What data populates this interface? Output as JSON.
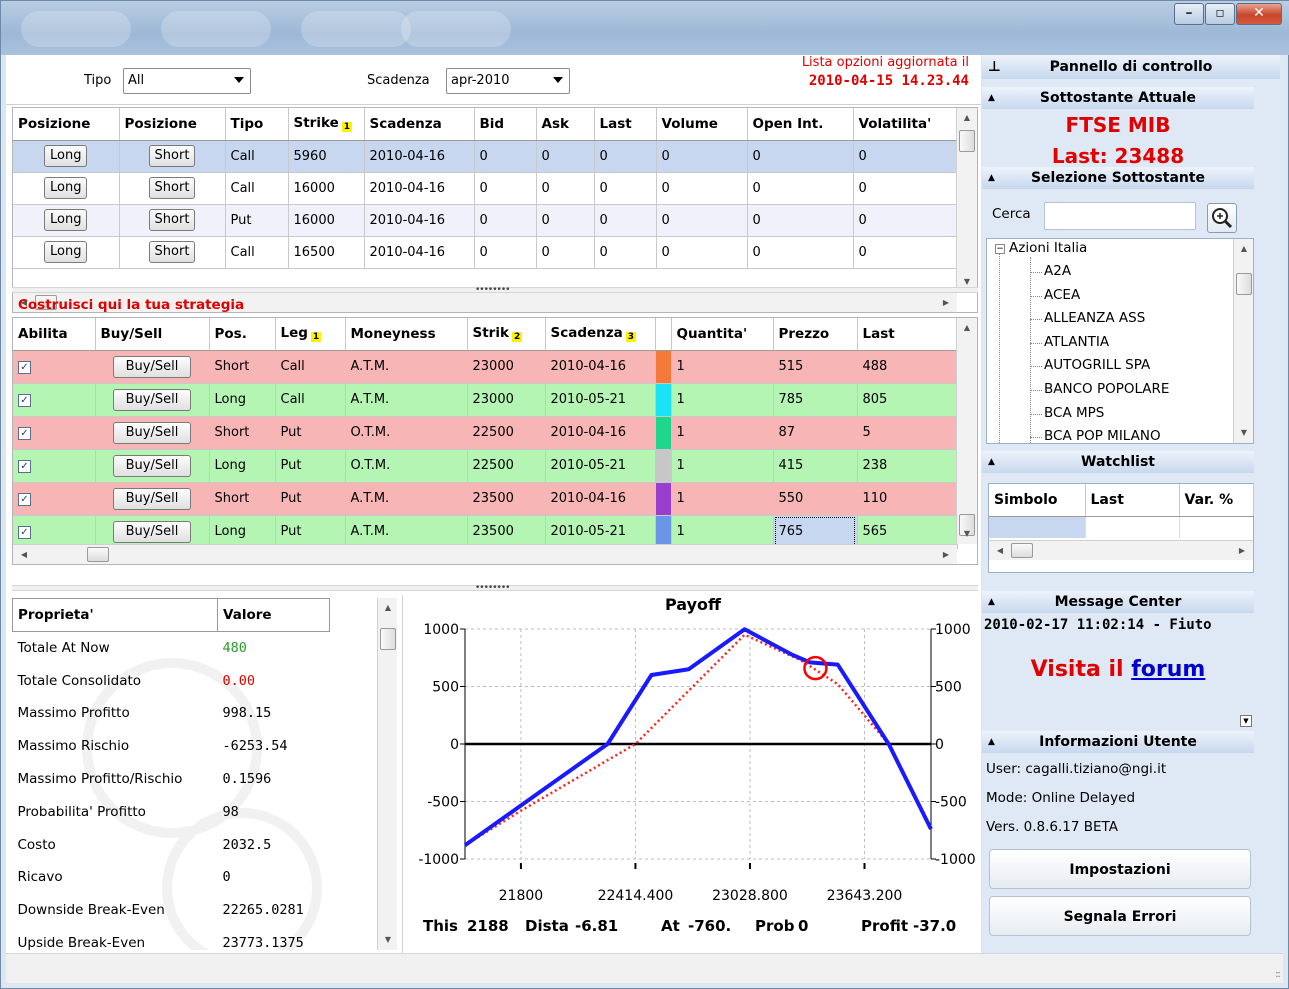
{
  "window": {
    "controls": [
      "minimize",
      "maximize",
      "close"
    ]
  },
  "filters": {
    "tipo_label": "Tipo",
    "tipo_value": "All",
    "scadenza_label": "Scadenza",
    "scadenza_value": "apr-2010",
    "updated_label": "Lista opzioni aggiornata il",
    "updated_value": "2010-04-15 14.23.44"
  },
  "options_table": {
    "columns": [
      "Posizione",
      "Posizione",
      "Tipo",
      "Strike",
      "Scadenza",
      "Bid",
      "Ask",
      "Last",
      "Volume",
      "Open Int.",
      "Volatilita'"
    ],
    "sort_badge": "1",
    "long_label": "Long",
    "short_label": "Short",
    "rows": [
      {
        "tipo": "Call",
        "strike": "5960",
        "scadenza": "2010-04-16",
        "bid": "0",
        "ask": "0",
        "last": "0",
        "volume": "0",
        "open_int": "0",
        "volatilita": "0"
      },
      {
        "tipo": "Call",
        "strike": "16000",
        "scadenza": "2010-04-16",
        "bid": "0",
        "ask": "0",
        "last": "0",
        "volume": "0",
        "open_int": "0",
        "volatilita": "0"
      },
      {
        "tipo": "Put",
        "strike": "16000",
        "scadenza": "2010-04-16",
        "bid": "0",
        "ask": "0",
        "last": "0",
        "volume": "0",
        "open_int": "0",
        "volatilita": "0"
      },
      {
        "tipo": "Call",
        "strike": "16500",
        "scadenza": "2010-04-16",
        "bid": "0",
        "ask": "0",
        "last": "0",
        "volume": "0",
        "open_int": "0",
        "volatilita": "0"
      }
    ]
  },
  "strategy": {
    "title": "Costruisci qui la tua strategia",
    "columns": [
      "Abilita",
      "Buy/Sell",
      "Pos.",
      "Leg",
      "Moneyness",
      "Strik",
      "Scadenza",
      "",
      "Quantita'",
      "Prezzo",
      "Last"
    ],
    "badges": {
      "leg": "1",
      "strik": "2",
      "scadenza": "3"
    },
    "button_label": "Buy/Sell",
    "check_glyph": "✓",
    "rows": [
      {
        "pos": "Short",
        "leg": "Call",
        "moneyness": "A.T.M.",
        "strik": "23000",
        "scadenza": "2010-04-16",
        "color": "#f4793a",
        "quantita": "1",
        "prezzo": "515",
        "last": "488"
      },
      {
        "pos": "Long",
        "leg": "Call",
        "moneyness": "A.T.M.",
        "strik": "23000",
        "scadenza": "2010-05-21",
        "color": "#18e2f4",
        "quantita": "1",
        "prezzo": "785",
        "last": "805"
      },
      {
        "pos": "Short",
        "leg": "Put",
        "moneyness": "O.T.M.",
        "strik": "22500",
        "scadenza": "2010-04-16",
        "color": "#1ed78d",
        "quantita": "1",
        "prezzo": "87",
        "last": "5"
      },
      {
        "pos": "Long",
        "leg": "Put",
        "moneyness": "O.T.M.",
        "strik": "22500",
        "scadenza": "2010-05-21",
        "color": "#c7c7c7",
        "quantita": "1",
        "prezzo": "415",
        "last": "238"
      },
      {
        "pos": "Short",
        "leg": "Put",
        "moneyness": "A.T.M.",
        "strik": "23500",
        "scadenza": "2010-04-16",
        "color": "#9a3ecf",
        "quantita": "1",
        "prezzo": "550",
        "last": "110"
      },
      {
        "pos": "Long",
        "leg": "Put",
        "moneyness": "A.T.M.",
        "strik": "23500",
        "scadenza": "2010-05-21",
        "color": "#6b96e8",
        "quantita": "1",
        "prezzo": "765",
        "last": "565"
      }
    ]
  },
  "properties": {
    "col_prop": "Proprieta'",
    "col_val": "Valore",
    "rows": [
      {
        "name": "Totale At Now",
        "value": "480",
        "color": "#2a9d2a"
      },
      {
        "name": "Totale Consolidato",
        "value": "0.00",
        "color": "#e00000"
      },
      {
        "name": "Massimo Profitto",
        "value": "998.15",
        "color": "#000000"
      },
      {
        "name": "Massimo Rischio",
        "value": "-6253.54",
        "color": "#000000"
      },
      {
        "name": "Massimo Profitto/Rischio",
        "value": "0.1596",
        "color": "#000000"
      },
      {
        "name": "Probabilita' Profitto",
        "value": "98",
        "color": "#000000"
      },
      {
        "name": "Costo",
        "value": "2032.5",
        "color": "#000000"
      },
      {
        "name": "Ricavo",
        "value": "0",
        "color": "#000000"
      },
      {
        "name": "Downside Break-Even",
        "value": "22265.0281",
        "color": "#000000"
      },
      {
        "name": "Upside Break-Even",
        "value": "23773.1375",
        "color": "#000000"
      }
    ]
  },
  "chart_data": {
    "type": "line",
    "title": "Payoff",
    "xlim": [
      21500,
      24000
    ],
    "ylim": [
      -1000,
      1000
    ],
    "y_ticks": [
      1000,
      500,
      0,
      -500,
      -1000
    ],
    "y_tick_labels": [
      "1000",
      "500",
      "0",
      "-500",
      "-1000"
    ],
    "x_tick_labels": [
      "21800",
      "22414.400",
      "23028.800",
      "23643.200"
    ],
    "x_tick_values": [
      21800,
      22414.4,
      23028.8,
      23643.2
    ],
    "grid": true,
    "series": [
      {
        "color": "#1a1aff",
        "style": "solid",
        "x": [
          21500,
          21900,
          22265,
          22500,
          22700,
          23000,
          23250,
          23350,
          23500,
          23773,
          24000
        ],
        "y": [
          -880,
          -420,
          0,
          600,
          650,
          998,
          780,
          710,
          690,
          0,
          -740
        ]
      },
      {
        "color": "#ff2020",
        "style": "dotted",
        "x": [
          21500,
          21800,
          22414.4,
          23000,
          23300,
          23500,
          23773,
          24000
        ],
        "y": [
          -880,
          -580,
          0,
          950,
          730,
          520,
          0,
          -740
        ]
      }
    ],
    "marker": {
      "x": 23380,
      "y": 660
    },
    "footer": {
      "this_label": "This",
      "this_value": "2188",
      "dista_label": "Dista",
      "dista_value": "-6.81",
      "at_label": "At",
      "at_value": "-760.",
      "prob_label": "Prob",
      "prob_value": "0",
      "profit_label": "Profit",
      "profit_value": "-37.0"
    }
  },
  "panel": {
    "title": "Pannello di controllo",
    "sottostante": {
      "header": "Sottostante Attuale",
      "name": "FTSE MIB",
      "last": "Last: 23488"
    },
    "selezione": {
      "header": "Selezione Sottostante",
      "search_label": "Cerca",
      "search_value": "",
      "root": "Azioni Italia",
      "items": [
        "A2A",
        "ACEA",
        "ALLEANZA ASS",
        "ATLANTIA",
        "AUTOGRILL SPA",
        "BANCO POPOLARE",
        "BCA MPS",
        "BCA POP MILANO"
      ]
    },
    "watchlist": {
      "header": "Watchlist",
      "columns": [
        "Simbolo",
        "Last",
        "Var. %"
      ]
    },
    "messages": {
      "header": "Message Center",
      "entry": "2010-02-17 11:02:14 - Fiuto",
      "visit_text": "Visita il",
      "link_text": "forum"
    },
    "user": {
      "header": "Informazioni Utente",
      "user_line": "User: cagalli.tiziano@ngi.it",
      "mode_line": "Mode: Online Delayed",
      "version_line": "Vers. 0.8.6.17 BETA",
      "settings_button": "Impostazioni",
      "report_button": "Segnala Errori"
    }
  }
}
